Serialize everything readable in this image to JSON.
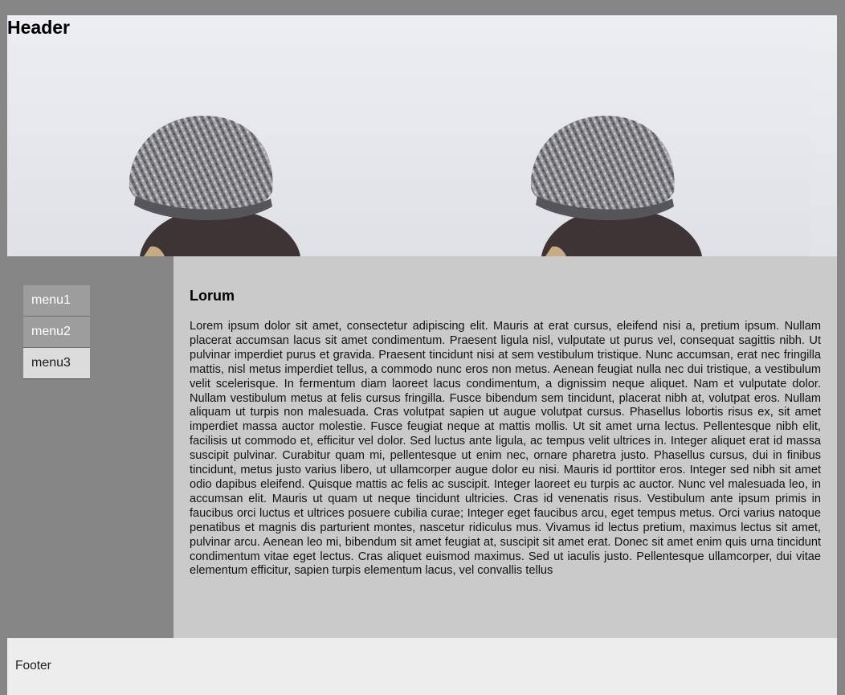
{
  "header": {
    "title": "Header"
  },
  "sidebar": {
    "items": [
      {
        "label": "menu1"
      },
      {
        "label": "menu2"
      },
      {
        "label": "menu3"
      }
    ]
  },
  "main": {
    "title": "Lorum",
    "body": "Lorem ipsum dolor sit amet, consectetur adipiscing elit. Mauris at erat cursus, eleifend nisi a, pretium ipsum. Nullam placerat accumsan lacus sit amet condimentum. Praesent ligula nisl, vulputate ut purus vel, consequat sagittis nibh. Ut pulvinar imperdiet purus et gravida. Praesent tincidunt nisi at sem vestibulum tristique. Nunc accumsan, erat nec fringilla mattis, nisl metus imperdiet tellus, a commodo nunc eros non metus. Aenean feugiat nulla nec dui tristique, a vestibulum velit scelerisque. In fermentum diam laoreet lacus condimentum, a dignissim neque aliquet. Nam et vulputate dolor. Nullam vestibulum metus at felis cursus fringilla. Fusce bibendum sem tincidunt, placerat nibh at, volutpat eros. Nullam aliquam ut turpis non malesuada. Cras volutpat sapien ut augue volutpat cursus. Phasellus lobortis risus ex, sit amet imperdiet massa auctor molestie. Fusce feugiat neque at mattis mollis. Ut sit amet urna lectus. Pellentesque nibh elit, facilisis ut commodo et, efficitur vel dolor. Sed luctus ante ligula, ac tempus velit ultrices in. Integer aliquet erat id massa suscipit pulvinar. Curabitur quam mi, pellentesque ut enim nec, ornare pharetra justo. Phasellus cursus, dui in finibus tincidunt, metus justo varius libero, ut ullamcorper augue dolor eu nisi. Mauris id porttitor eros. Integer sed nibh sit amet odio dapibus eleifend. Quisque mattis ac felis ac suscipit. Integer laoreet eu turpis ac auctor. Nunc vel malesuada leo, in accumsan elit. Mauris ut quam ut neque tincidunt ultricies. Cras id venenatis risus. Vestibulum ante ipsum primis in faucibus orci luctus et ultrices posuere cubilia curae; Integer eget faucibus arcu, eget tempus metus. Orci varius natoque penatibus et magnis dis parturient montes, nascetur ridiculus mus. Vivamus id lectus pretium, maximus lectus sit amet, pulvinar arcu. Aenean leo mi, bibendum sit amet feugiat at, suscipit sit amet erat. Donec sit amet enim quis urna tincidunt condimentum vitae eget lectus. Cras aliquet euismod maximus. Sed ut iaculis justo. Pellentesque ullamcorper, dui vitae elementum efficitur, sapien turpis elementum lacus, vel convallis tellus"
  },
  "footer": {
    "text": "Footer"
  },
  "colors": {
    "page_background": "#858585",
    "sidebar_background": "#858585",
    "content_background": "#cacaca",
    "footer_background": "#ededed",
    "menu_item_dark": "#9d9d9d",
    "menu_item_light": "#dcdcdc"
  }
}
